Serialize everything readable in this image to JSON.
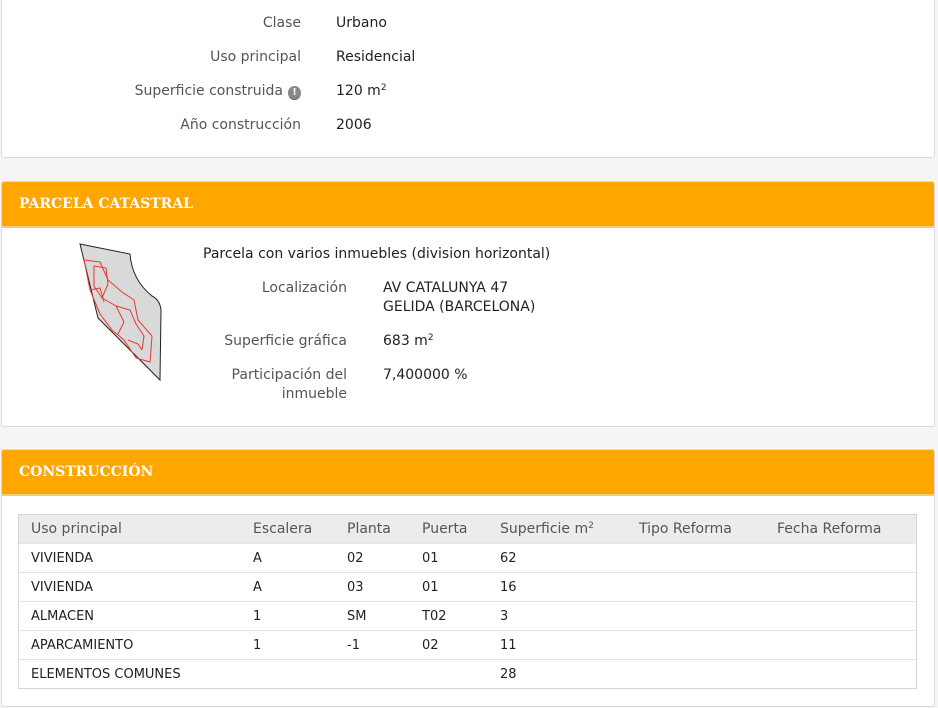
{
  "inmueble": {
    "clase_label": "Clase",
    "clase_value": "Urbano",
    "uso_label": "Uso principal",
    "uso_value": "Residencial",
    "superficie_label": "Superficie construida",
    "superficie_value": "120 m",
    "superficie_unit_exp": "2",
    "anio_label": "Año construcción",
    "anio_value": "2006"
  },
  "parcela": {
    "title": "PARCELA CATASTRAL",
    "description": "Parcela con varios inmuebles (division horizontal)",
    "localizacion_label": "Localización",
    "localizacion_line1": "AV CATALUNYA 47",
    "localizacion_line2": "GELIDA (BARCELONA)",
    "superficie_label": "Superficie gráfica",
    "superficie_value": "683 m",
    "superficie_unit_exp": "2",
    "participacion_label_line1": "Participación del",
    "participacion_label_line2": "inmueble",
    "participacion_value": "7,400000 %"
  },
  "construccion": {
    "title": "CONSTRUCCIÓN",
    "columns": [
      "Uso principal",
      "Escalera",
      "Planta",
      "Puerta",
      "Superficie m",
      "Tipo Reforma",
      "Fecha Reforma"
    ],
    "superficie_col_exp": "2",
    "rows": [
      [
        "VIVIENDA",
        "A",
        "02",
        "01",
        "62",
        "",
        ""
      ],
      [
        "VIVIENDA",
        "A",
        "03",
        "01",
        "16",
        "",
        ""
      ],
      [
        "ALMACEN",
        "1",
        "SM",
        "T02",
        "3",
        "",
        ""
      ],
      [
        "APARCAMIENTO",
        "1",
        "-1",
        "02",
        "11",
        "",
        ""
      ],
      [
        "ELEMENTOS COMUNES",
        "",
        "",
        "",
        "28",
        "",
        ""
      ]
    ]
  },
  "colors": {
    "header_bg": "#ffa600",
    "plot_outline": "#e53935",
    "parcel_fill": "#d9d9d9"
  }
}
